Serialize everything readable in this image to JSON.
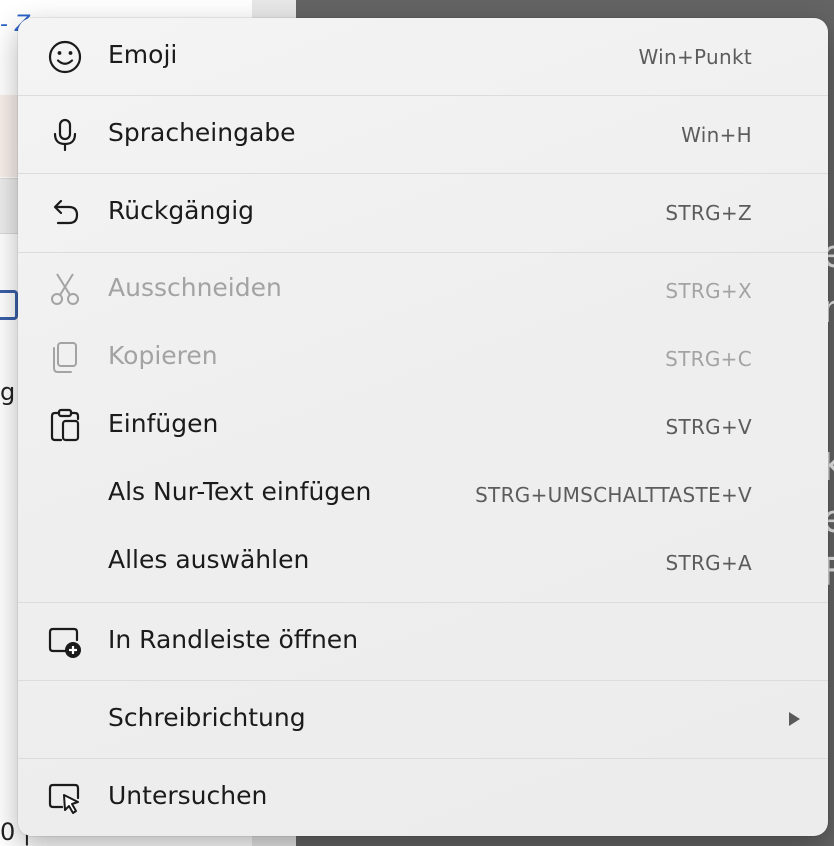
{
  "background": {
    "top_link": "- Z",
    "left_fragment_1": "g",
    "left_fragment_2": "0 |",
    "right_fragments": [
      "e",
      "n",
      "K",
      "e",
      "F"
    ]
  },
  "menu": {
    "items": [
      {
        "label": "Emoji",
        "shortcut": "Win+Punkt",
        "icon": "smiley-icon",
        "disabled": false
      },
      {
        "label": "Spracheingabe",
        "shortcut": "Win+H",
        "icon": "microphone-icon",
        "disabled": false
      },
      {
        "label": "Rückgängig",
        "shortcut": "STRG+Z",
        "icon": "undo-icon",
        "disabled": false
      },
      {
        "label": "Ausschneiden",
        "shortcut": "STRG+X",
        "icon": "scissors-icon",
        "disabled": true
      },
      {
        "label": "Kopieren",
        "shortcut": "STRG+C",
        "icon": "copy-icon",
        "disabled": true
      },
      {
        "label": "Einfügen",
        "shortcut": "STRG+V",
        "icon": "clipboard-paste-icon",
        "disabled": false
      },
      {
        "label": "Als Nur-Text einfügen",
        "shortcut": "STRG+UMSCHALTTASTE+V",
        "icon": "",
        "disabled": false
      },
      {
        "label": "Alles auswählen",
        "shortcut": "STRG+A",
        "icon": "",
        "disabled": false
      },
      {
        "label": "In Randleiste öffnen",
        "shortcut": "",
        "icon": "sidebar-add-icon",
        "disabled": false
      },
      {
        "label": "Schreibrichtung",
        "shortcut": "",
        "icon": "",
        "submenu": true,
        "disabled": false
      },
      {
        "label": "Untersuchen",
        "shortcut": "",
        "icon": "inspect-icon",
        "disabled": false
      }
    ]
  },
  "colors": {
    "menu_bg": "#eeeeee",
    "text": "#1b1b1b",
    "disabled_text": "#a3a3a3",
    "shortcut_text": "#5c5c5c",
    "backdrop": "#646464"
  }
}
